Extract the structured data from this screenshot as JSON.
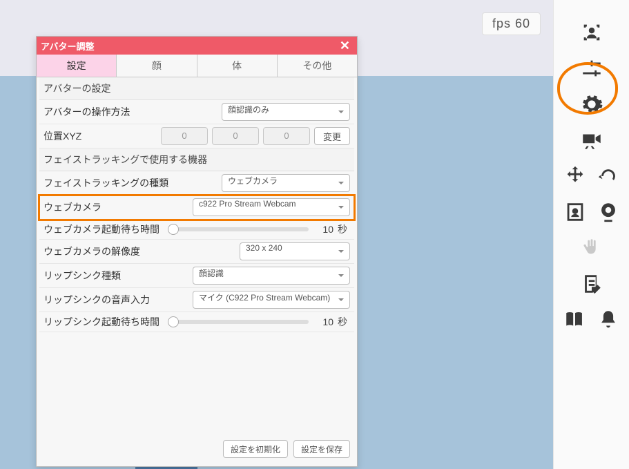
{
  "fps": {
    "label": "fps",
    "value": "60"
  },
  "dialog": {
    "title": "アバター調整",
    "tabs": [
      "設定",
      "顔",
      "体",
      "その他"
    ],
    "activeTab": 0,
    "section_avatar": "アバターの設定",
    "row_control": {
      "label": "アバターの操作方法",
      "value": "顔認識のみ"
    },
    "row_pos": {
      "label": "位置XYZ",
      "x": "0",
      "y": "0",
      "z": "0",
      "btn": "変更"
    },
    "section_face": "フェイストラッキングで使用する機器",
    "row_track_type": {
      "label": "フェイストラッキングの種類",
      "value": "ウェブカメラ"
    },
    "row_webcam": {
      "label": "ウェブカメラ",
      "value": "c922 Pro Stream Webcam"
    },
    "row_webcam_wait": {
      "label": "ウェブカメラ起動待ち時間",
      "value": "10",
      "unit": "秒"
    },
    "row_webcam_res": {
      "label": "ウェブカメラの解像度",
      "value": "320 x 240"
    },
    "row_lip": {
      "label": "リップシンク種類",
      "value": "顔認識"
    },
    "row_lip_audio": {
      "label": "リップシンクの音声入力",
      "value": "マイク (C922 Pro Stream Webcam)"
    },
    "row_lip_wait": {
      "label": "リップシンク起動待ち時間",
      "value": "10",
      "unit": "秒"
    },
    "footer": {
      "reset": "設定を初期化",
      "save": "設定を保存"
    }
  },
  "toolbar_icons": [
    "avatar-icon",
    "sliders-icon",
    "gear-icon",
    "camera-icon",
    "move-rotate-icon",
    "portrait-webcam-icon",
    "hand-icon",
    "note-icon",
    "book-bell-icon"
  ]
}
